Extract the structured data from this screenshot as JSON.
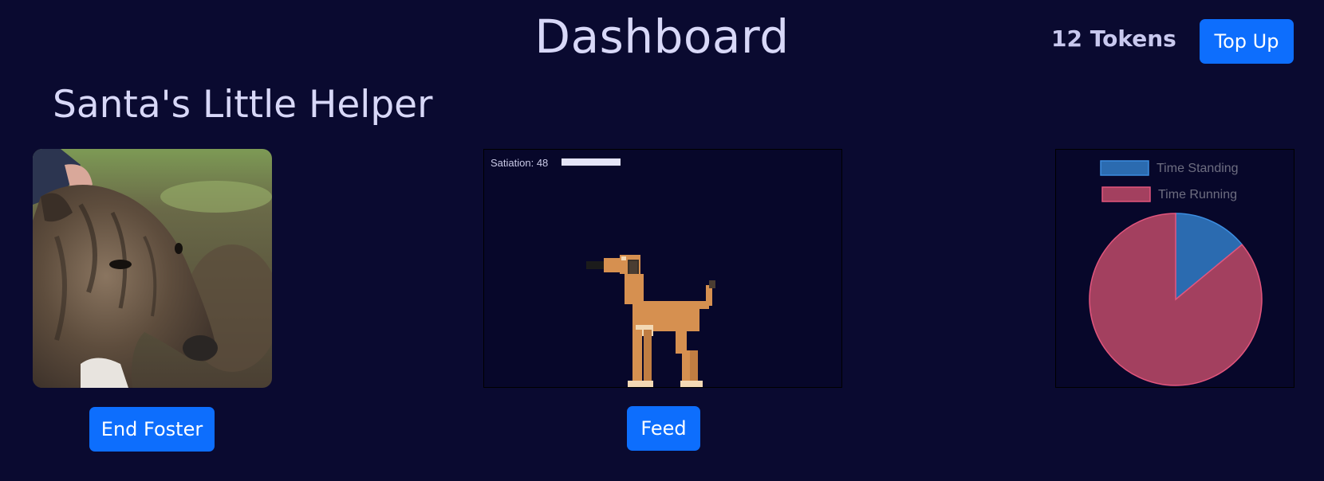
{
  "header": {
    "title": "Dashboard",
    "tokens": "12 Tokens",
    "topup_label": "Top Up"
  },
  "pet": {
    "name": "Santa's Little Helper",
    "photo_subject": "brindle-greyhound-photo",
    "end_foster_label": "End Foster"
  },
  "game": {
    "satiation_label": "Satiation: 48",
    "satiation_value": 48,
    "satiation_max": 100,
    "feed_label": "Feed"
  },
  "chart_data": {
    "type": "pie",
    "labels": [
      "Time Standing",
      "Time Running"
    ],
    "values": [
      14,
      86
    ],
    "colors": [
      "#2b6bb0",
      "#a3405f"
    ],
    "border_colors": [
      "#3c8de0",
      "#e2557d"
    ],
    "legend_position": "top"
  },
  "colors": {
    "background": "#0a0a30",
    "accent": "#0d6efd"
  }
}
